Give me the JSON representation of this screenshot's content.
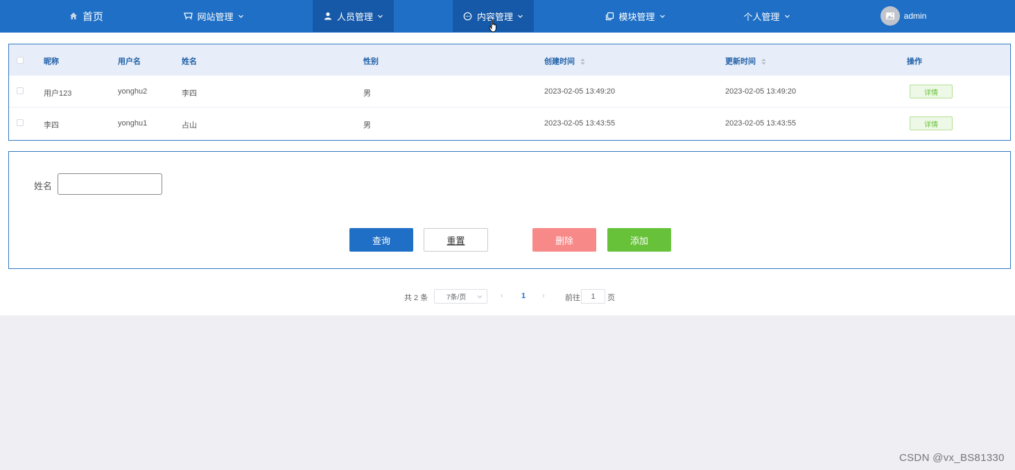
{
  "nav": {
    "home": "首页",
    "site_mgmt": "网站管理",
    "staff_mgmt": "人员管理",
    "content_mgmt": "内容管理",
    "module_mgmt": "模块管理",
    "personal_mgmt": "个人管理",
    "user": "admin",
    "colors": {
      "bar": "#1e6fc5",
      "active": "#1659a8"
    }
  },
  "table": {
    "columns": [
      "昵称",
      "用户名",
      "姓名",
      "性别",
      "创建时间",
      "更新时间",
      "操作"
    ],
    "rows": [
      {
        "nickname": "用户123",
        "username": "yonghu2",
        "name": "李四",
        "gender": "男",
        "created": "2023-02-05 13:49:20",
        "updated": "2023-02-05 13:49:20",
        "action": "详情"
      },
      {
        "nickname": "李四",
        "username": "yonghu1",
        "name": "占山",
        "gender": "男",
        "created": "2023-02-05 13:43:55",
        "updated": "2023-02-05 13:43:55",
        "action": "详情"
      }
    ]
  },
  "search": {
    "name_label": "姓名",
    "name_value": "",
    "query": "查询",
    "reset": "重置",
    "delete": "删除",
    "add": "添加"
  },
  "pagination": {
    "total": "共 2 条",
    "page_size": "7条/页",
    "current": "1",
    "goto": "前往",
    "goto_value": "1",
    "page_unit": "页"
  },
  "watermark": "CSDN @vx_BS81330"
}
